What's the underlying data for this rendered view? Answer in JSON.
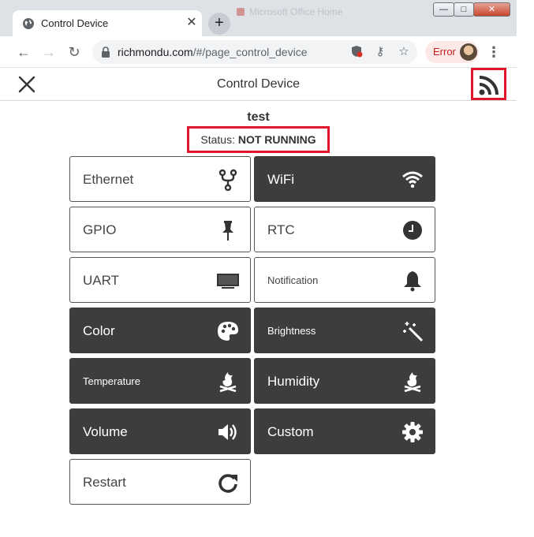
{
  "browser": {
    "tab_title": "Control Device",
    "tab_close": "✕",
    "new_tab": "+",
    "bg_tab_title": "Microsoft Office Home",
    "url_host": "richmondu.com",
    "url_path": "/#/page_control_device",
    "error_label": "Error",
    "window_controls": {
      "minimize": "—",
      "maximize": "□",
      "close": "✕"
    }
  },
  "app": {
    "title": "Control Device",
    "device_name": "test",
    "status_label": "Status: ",
    "status_value": "NOT RUNNING"
  },
  "tiles": [
    {
      "label": "Ethernet",
      "style": "light",
      "icon": "network-fork-icon"
    },
    {
      "label": "WiFi",
      "style": "dark",
      "icon": "wifi-icon"
    },
    {
      "label": "GPIO",
      "style": "light",
      "icon": "pushpin-icon"
    },
    {
      "label": "RTC",
      "style": "light",
      "icon": "clock-icon"
    },
    {
      "label": "UART",
      "style": "light",
      "icon": "monitor-icon"
    },
    {
      "label": "Notification",
      "style": "light",
      "icon": "bell-icon"
    },
    {
      "label": "Color",
      "style": "dark",
      "icon": "palette-icon"
    },
    {
      "label": "Brightness",
      "style": "dark",
      "icon": "magic-wand-icon"
    },
    {
      "label": "Temperature",
      "style": "dark",
      "icon": "fire-icon"
    },
    {
      "label": "Humidity",
      "style": "dark",
      "icon": "fire-icon"
    },
    {
      "label": "Volume",
      "style": "dark",
      "icon": "volume-icon"
    },
    {
      "label": "Custom",
      "style": "dark",
      "icon": "gear-icon"
    },
    {
      "label": "Restart",
      "style": "light",
      "icon": "redo-icon"
    }
  ],
  "colors": {
    "highlight": "#e0162b",
    "dark_tile": "#3d3d3d"
  }
}
